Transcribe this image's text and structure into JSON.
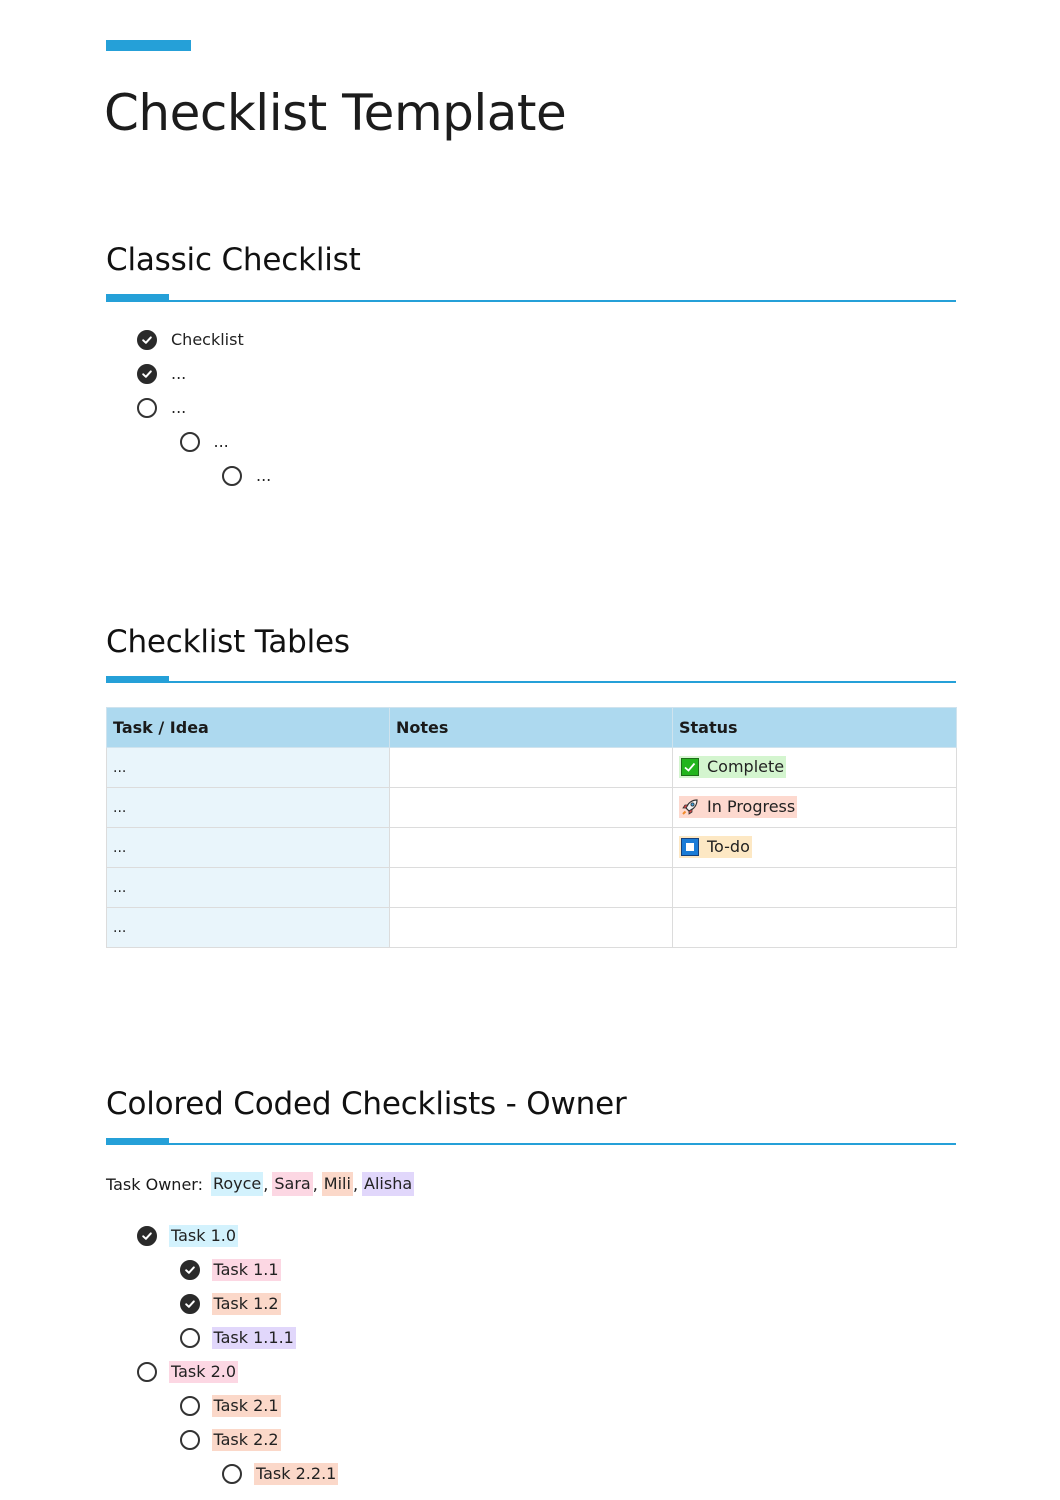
{
  "page": {
    "title": "Checklist Template",
    "accent_color": "#25a0d8"
  },
  "classic": {
    "heading": "Classic Checklist",
    "items": [
      {
        "label": "Checklist",
        "checked": true,
        "level": 0
      },
      {
        "label": "...",
        "checked": true,
        "level": 0
      },
      {
        "label": "...",
        "checked": false,
        "level": 0
      },
      {
        "label": "...",
        "checked": false,
        "level": 1
      },
      {
        "label": "...",
        "checked": false,
        "level": 2
      }
    ]
  },
  "tables": {
    "heading": "Checklist Tables",
    "columns": [
      "Task / Idea",
      "Notes",
      "Status"
    ],
    "rows": [
      {
        "task": "...",
        "notes": "",
        "status": "Complete",
        "status_icon": "check-box-icon",
        "status_color": "#d4f5cf"
      },
      {
        "task": "...",
        "notes": "",
        "status": "In Progress",
        "status_icon": "rocket-icon",
        "status_color": "#fdd9cf"
      },
      {
        "task": "...",
        "notes": "",
        "status": "To-do",
        "status_icon": "stop-square-icon",
        "status_color": "#fde8c4"
      },
      {
        "task": "...",
        "notes": "",
        "status": ""
      },
      {
        "task": "...",
        "notes": "",
        "status": ""
      }
    ]
  },
  "owners": {
    "heading": "Colored Coded Checklists - Owner",
    "label": "Task Owner:",
    "people": [
      {
        "name": "Royce",
        "color": "#d3f2fd"
      },
      {
        "name": "Sara",
        "color": "#fcd7e3"
      },
      {
        "name": "Mili",
        "color": "#fbd8c9"
      },
      {
        "name": "Alisha",
        "color": "#e1d7fb"
      }
    ],
    "items": [
      {
        "label": "Task 1.0",
        "checked": true,
        "level": 0,
        "owner": "Royce"
      },
      {
        "label": "Task 1.1",
        "checked": true,
        "level": 1,
        "owner": "Sara"
      },
      {
        "label": "Task 1.2",
        "checked": true,
        "level": 1,
        "owner": "Mili"
      },
      {
        "label": "Task 1.1.1",
        "checked": false,
        "level": 1,
        "owner": "Alisha"
      },
      {
        "label": "Task 2.0",
        "checked": false,
        "level": 0,
        "owner": "Sara"
      },
      {
        "label": "Task 2.1",
        "checked": false,
        "level": 1,
        "owner": "Mili"
      },
      {
        "label": "Task 2.2",
        "checked": false,
        "level": 1,
        "owner": "Mili"
      },
      {
        "label": "Task 2.2.1",
        "checked": false,
        "level": 2,
        "owner": "Mili"
      }
    ]
  }
}
